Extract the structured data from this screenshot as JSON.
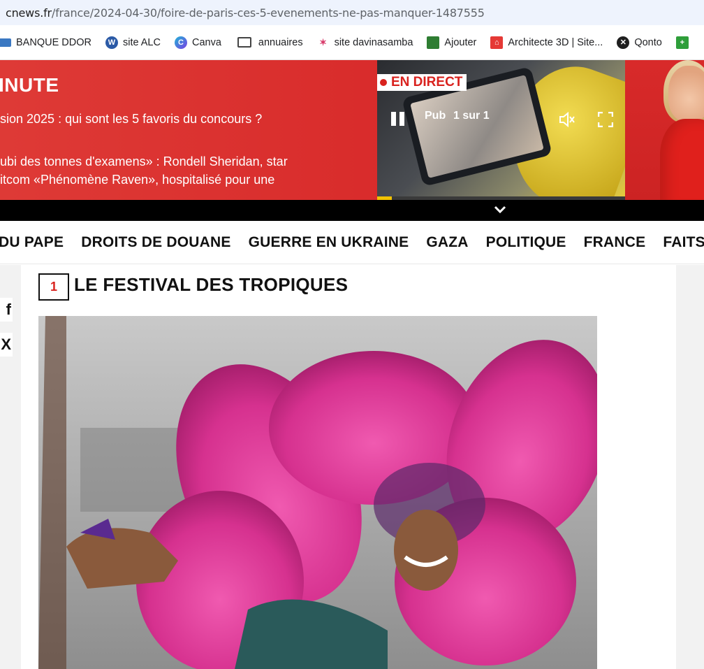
{
  "browser": {
    "url_domain": "cnews.fr",
    "url_path": "/france/2024-04-30/foire-de-paris-ces-5-evenements-ne-pas-manquer-1487555"
  },
  "bookmarks": [
    {
      "label": "BANQUE DDOR",
      "icon": "bank-icon",
      "color": "#3a78c2"
    },
    {
      "label": "site ALC",
      "icon": "wordpress-icon",
      "color": "#2b5aa6"
    },
    {
      "label": "Canva",
      "icon": "canva-icon",
      "color": "#1fb3d6"
    },
    {
      "label": "annuaires",
      "icon": "folder-icon",
      "color": "#5f6368"
    },
    {
      "label": "site davinasamba",
      "icon": "samba-logo-icon",
      "color": "#d83a6a"
    },
    {
      "label": "Ajouter",
      "icon": "book-icon",
      "color": "#2e7d32"
    },
    {
      "label": "Architecte 3D | Site...",
      "icon": "house-icon",
      "color": "#e53935"
    },
    {
      "label": "Qonto",
      "icon": "qonto-icon",
      "color": "#1f1f1f"
    },
    {
      "label": "",
      "icon": "plus-icon",
      "color": "#2e9e3a"
    }
  ],
  "ticker": {
    "heading": "INUTE",
    "headline1": "sion 2025 : qui sont les 5 favoris du concours ?",
    "headline2_line1": "ubi des tonnes d'examens» : Rondell Sheridan, star",
    "headline2_line2": "itcom «Phénomène Raven», hospitalisé pour une"
  },
  "video": {
    "live_label": "EN DIRECT",
    "ad_label": "Pub",
    "ad_count": "1 sur 1",
    "progress": 0.06,
    "accent": "#f2c200"
  },
  "nav": {
    "items": [
      "DU PAPE",
      "DROITS DE DOUANE",
      "GUERRE EN UKRAINE",
      "GAZA",
      "POLITIQUE",
      "FRANCE",
      "FAITS DI"
    ]
  },
  "share": {
    "facebook_glyph": "f",
    "x_glyph": "X"
  },
  "article": {
    "number": "1",
    "section_title": "LE FESTIVAL DES TROPIQUES"
  },
  "colors": {
    "brand_red": "#d9221e",
    "nav_text": "#111111"
  }
}
